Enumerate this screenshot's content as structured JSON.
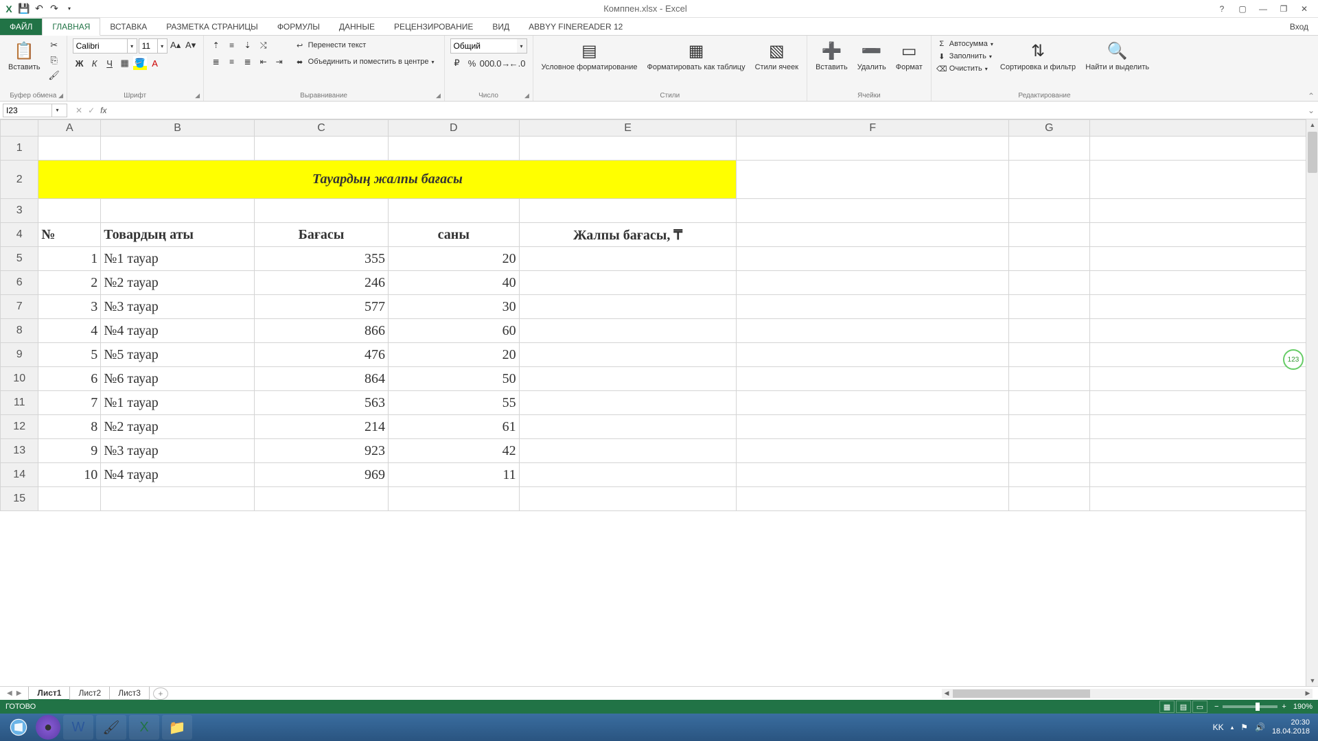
{
  "app": {
    "title_doc": "Комппен.xlsx",
    "title_app": "Excel"
  },
  "qat": {
    "save": "💾",
    "undo": "↶",
    "redo": "↷"
  },
  "tabs": {
    "file": "ФАЙЛ",
    "home": "ГЛАВНАЯ",
    "insert": "ВСТАВКА",
    "layout": "РАЗМЕТКА СТРАНИЦЫ",
    "formulas": "ФОРМУЛЫ",
    "data": "ДАННЫЕ",
    "review": "РЕЦЕНЗИРОВАНИЕ",
    "view": "ВИД",
    "abbyy": "ABBYY FineReader 12",
    "signin": "Вход"
  },
  "ribbon": {
    "clipboard": {
      "paste": "Вставить",
      "group": "Буфер обмена"
    },
    "font": {
      "name": "Calibri",
      "size": "11",
      "bold": "Ж",
      "italic": "К",
      "underline": "Ч",
      "group": "Шрифт"
    },
    "alignment": {
      "wrap": "Перенести текст",
      "merge": "Объединить и поместить в центре",
      "group": "Выравнивание"
    },
    "number": {
      "format": "Общий",
      "group": "Число"
    },
    "styles": {
      "conditional": "Условное форматирование",
      "as_table": "Форматировать как таблицу",
      "cell_styles": "Стили ячеек",
      "group": "Стили"
    },
    "cells": {
      "insert": "Вставить",
      "delete": "Удалить",
      "format": "Формат",
      "group": "Ячейки"
    },
    "editing": {
      "autosum": "Автосумма",
      "fill": "Заполнить",
      "clear": "Очистить",
      "sort": "Сортировка и фильтр",
      "find": "Найти и выделить",
      "group": "Редактирование"
    }
  },
  "namebox": "I23",
  "columns": [
    "A",
    "B",
    "C",
    "D",
    "E",
    "F",
    "G"
  ],
  "title_cell": "Тауардың жалпы бағасы",
  "table": {
    "headers": {
      "num": "№",
      "name": "Товардың аты",
      "price": "Бағасы",
      "qty": "саны",
      "total": "Жалпы бағасы, ₸"
    },
    "rows": [
      {
        "n": "1",
        "name": "№1 тауар",
        "price": "355",
        "qty": "20"
      },
      {
        "n": "2",
        "name": "№2 тауар",
        "price": "246",
        "qty": "40"
      },
      {
        "n": "3",
        "name": "№3 тауар",
        "price": "577",
        "qty": "30"
      },
      {
        "n": "4",
        "name": "№4 тауар",
        "price": "866",
        "qty": "60"
      },
      {
        "n": "5",
        "name": "№5 тауар",
        "price": "476",
        "qty": "20"
      },
      {
        "n": "6",
        "name": "№6 тауар",
        "price": "864",
        "qty": "50"
      },
      {
        "n": "7",
        "name": "№1 тауар",
        "price": "563",
        "qty": "55"
      },
      {
        "n": "8",
        "name": "№2 тауар",
        "price": "214",
        "qty": "61"
      },
      {
        "n": "9",
        "name": "№3 тауар",
        "price": "923",
        "qty": "42"
      },
      {
        "n": "10",
        "name": "№4 тауар",
        "price": "969",
        "qty": "11"
      }
    ]
  },
  "sheets": {
    "s1": "Лист1",
    "s2": "Лист2",
    "s3": "Лист3"
  },
  "status": {
    "ready": "ГОТОВО",
    "zoom": "190%"
  },
  "tray": {
    "lang": "KK",
    "time": "20:30",
    "date": "18.04.2018"
  },
  "float_badge": "123"
}
